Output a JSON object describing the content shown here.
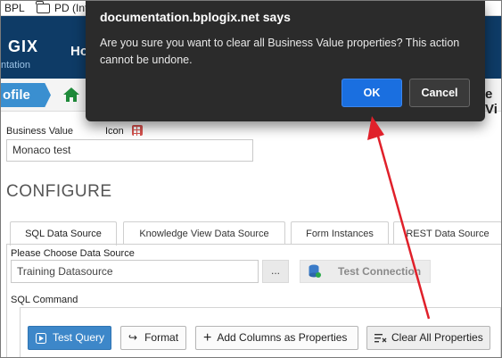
{
  "browser": {
    "bookmarks": [
      {
        "label": "BPL"
      },
      {
        "label": "PD (Int",
        "icon": "folder-icon"
      }
    ]
  },
  "header": {
    "logo_text": "GIX",
    "logo_sub": "ntation",
    "nav_item": "Ho"
  },
  "breadcrumb": {
    "profile": "ofile",
    "home_partial": "H",
    "right_partial": "e Vi"
  },
  "form": {
    "business_value_label": "Business Value",
    "icon_label": "Icon",
    "business_value": "Monaco test",
    "section_title": "CONFIGURE"
  },
  "tabs": [
    {
      "label": "SQL Data Source",
      "active": true
    },
    {
      "label": "Knowledge View Data Source",
      "active": false
    },
    {
      "label": "Form Instances",
      "active": false
    },
    {
      "label": "REST Data Source",
      "active": false
    }
  ],
  "datasource": {
    "label": "Please Choose Data Source",
    "value": "Training Datasource",
    "browse_label": "...",
    "test_connection_label": "Test Connection"
  },
  "sql": {
    "label": "SQL Command",
    "buttons": {
      "test_query": "Test Query",
      "format": "Format",
      "add_columns": "Add Columns as Properties",
      "clear_all": "Clear All Properties"
    }
  },
  "dialog": {
    "title": "documentation.bplogix.net says",
    "message": "Are you sure you want to clear all Business Value properties? This action cannot be undone.",
    "ok_label": "OK",
    "cancel_label": "Cancel"
  },
  "colors": {
    "header_bg": "#0e3b66",
    "accent_blue": "#3d87c9",
    "dialog_bg": "#2b2b2b",
    "dialog_ok": "#1a6fe0",
    "annotation_arrow": "#e0202a"
  }
}
